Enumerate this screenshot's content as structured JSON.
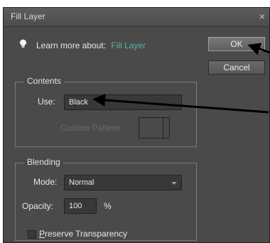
{
  "dialog": {
    "title": "Fill Layer",
    "close_glyph": "×",
    "learn_prefix": "Learn more about:",
    "learn_link": "Fill Layer",
    "ok_label": "OK",
    "cancel_label": "Cancel"
  },
  "contents": {
    "legend": "Contents",
    "use_label": "Use:",
    "use_value": "Black",
    "custom_pattern_label": "Custom Pattern:"
  },
  "blending": {
    "legend": "Blending",
    "mode_label": "Mode:",
    "mode_value": "Normal",
    "opacity_label": "Opacity:",
    "opacity_value": "100",
    "opacity_unit": "%",
    "preserve_prefix": "P",
    "preserve_rest": "reserve Transparency"
  }
}
